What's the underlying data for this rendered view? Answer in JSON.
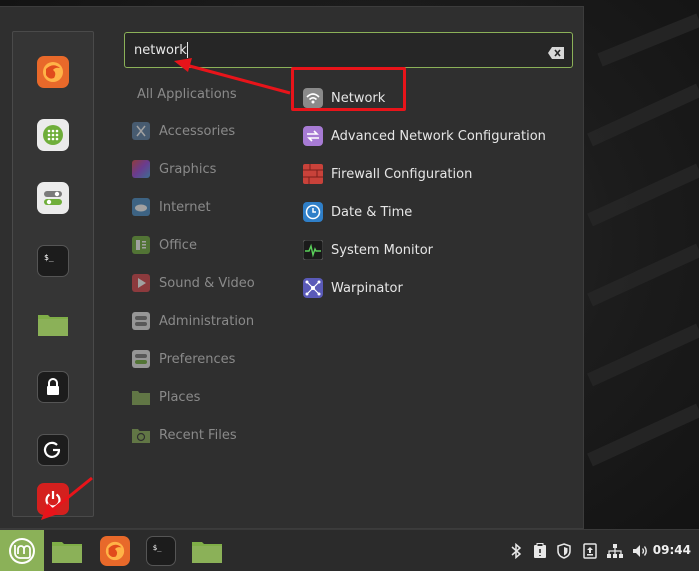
{
  "search": {
    "value": "network",
    "placeholder": ""
  },
  "favorites": [
    {
      "name": "firefox-icon"
    },
    {
      "name": "software-manager-icon"
    },
    {
      "name": "system-settings-icon"
    },
    {
      "name": "terminal-icon"
    },
    {
      "name": "files-icon"
    },
    {
      "name": "lock-screen-icon"
    },
    {
      "name": "logout-icon"
    },
    {
      "name": "shutdown-icon"
    }
  ],
  "categories": {
    "all_label": "All Applications",
    "items": [
      {
        "label": "Accessories",
        "icon": "accessories-icon"
      },
      {
        "label": "Graphics",
        "icon": "graphics-icon"
      },
      {
        "label": "Internet",
        "icon": "internet-icon"
      },
      {
        "label": "Office",
        "icon": "office-icon"
      },
      {
        "label": "Sound & Video",
        "icon": "sound-video-icon"
      },
      {
        "label": "Administration",
        "icon": "administration-icon"
      },
      {
        "label": "Preferences",
        "icon": "preferences-icon"
      },
      {
        "label": "Places",
        "icon": "places-icon"
      },
      {
        "label": "Recent Files",
        "icon": "recent-files-icon"
      }
    ]
  },
  "results": [
    {
      "label": "Network",
      "icon": "network-wifi-icon"
    },
    {
      "label": "Advanced Network Configuration",
      "icon": "advanced-network-icon"
    },
    {
      "label": "Firewall Configuration",
      "icon": "firewall-icon"
    },
    {
      "label": "Date & Time",
      "icon": "clock-icon"
    },
    {
      "label": "System Monitor",
      "icon": "system-monitor-icon"
    },
    {
      "label": "Warpinator",
      "icon": "warpinator-icon"
    }
  ],
  "taskbar": {
    "apps": [
      "files-icon",
      "firefox-icon",
      "terminal-icon",
      "files-icon"
    ],
    "tray": [
      "bluetooth-icon",
      "clipboard-icon",
      "shield-icon",
      "update-icon",
      "network-icon",
      "volume-icon"
    ],
    "clock": "09:44"
  },
  "colors": {
    "accent": "#8bb158",
    "highlight": "#e8141a",
    "menu_bg": "#2f2f2f"
  }
}
